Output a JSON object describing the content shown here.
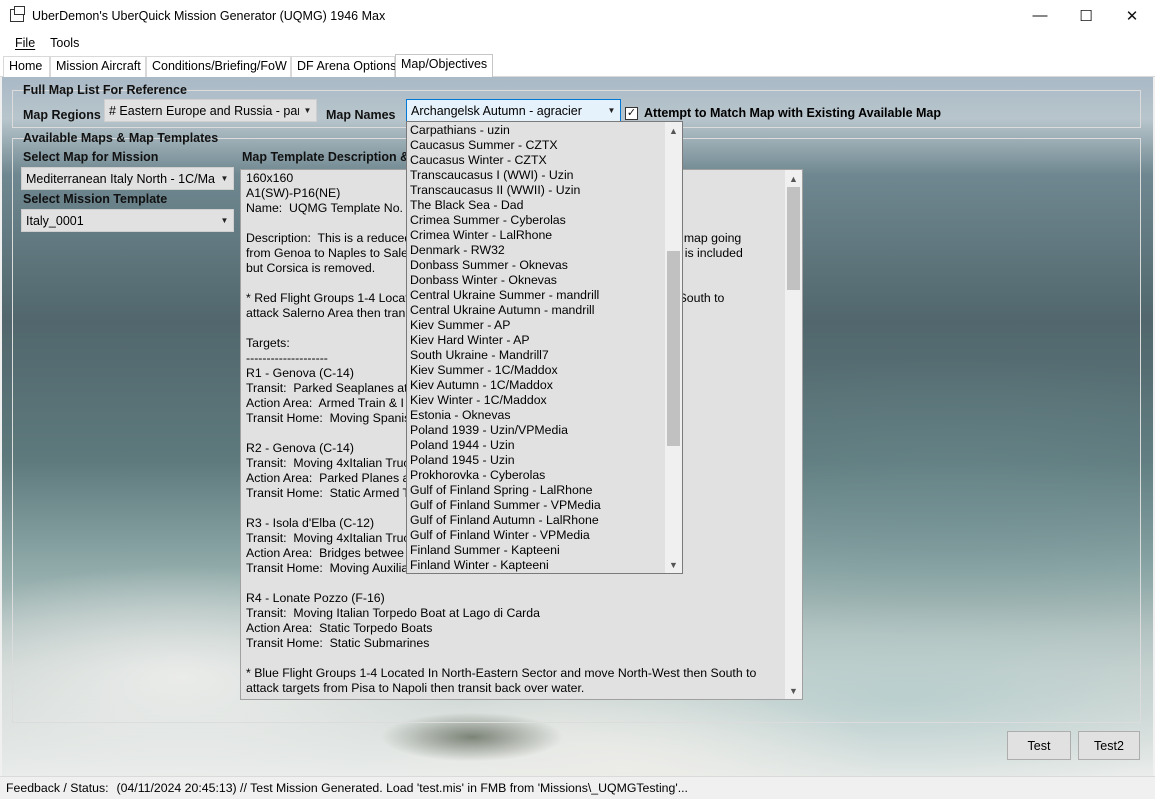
{
  "window": {
    "title": "UberDemon's UberQuick Mission Generator (UQMG) 1946 Max",
    "controls": {
      "minimize": "—",
      "maximize": "☐",
      "close": "✕"
    }
  },
  "menu": {
    "items": [
      {
        "label": "File"
      },
      {
        "label": "Tools"
      }
    ]
  },
  "tabs": [
    {
      "label": "Home"
    },
    {
      "label": "Mission Aircraft"
    },
    {
      "label": "Conditions/Briefing/FoW"
    },
    {
      "label": "DF Arena Options"
    },
    {
      "label": "Map/Objectives",
      "active": true
    }
  ],
  "full_map_list": {
    "group_label": "Full Map List For Reference",
    "regions_label": "Map Regions",
    "regions_value": "# Eastern Europe and Russia - part",
    "names_label": "Map Names",
    "names_value": "Archangelsk Autumn - agracier",
    "match_checkbox": {
      "checked": true,
      "label": "Attempt to Match Map with Existing Available Map"
    }
  },
  "available": {
    "group_label": "Available Maps & Map Templates",
    "select_map_label": "Select Map for Mission",
    "select_map_value": "Mediterranean Italy North - 1C/Ma",
    "select_template_label": "Select Mission Template",
    "select_template_value": "Italy_0001",
    "description_label": "Map Template Description & I"
  },
  "description_lines": [
    "160x160",
    "A1(SW)-P16(NE)",
    "Name:  UQMG Template No.",
    "",
    "Description:  This is a reduced                                                                          ale map going",
    "from Genoa to Naples to Sale                                                                            nd is included",
    "but Corsica is removed.",
    "",
    "* Red Flight Groups 1-4 Locat                                                                          en South to",
    "attack Salerno Area then tran",
    "",
    "Targets:",
    "--------------------",
    "R1 - Genova (C-14)",
    "Transit:  Parked Seaplanes at L",
    "Action Area:  Armed Train & I",
    "Transit Home:  Moving Spanis",
    "",
    "R2 - Genova (C-14)",
    "Transit:  Moving 4xItalian Truc",
    "Action Area:  Parked Planes at",
    "Transit Home:  Static Armed T",
    "",
    "R3 - Isola d'Elba (C-12)",
    "Transit:  Moving 4xItalian Truc",
    "Action Area:  Bridges betwee",
    "Transit Home:  Moving Auxilia",
    "",
    "R4 - Lonate Pozzo (F-16)",
    "Transit:  Moving Italian Torpedo Boat at Lago di Carda",
    "Action Area:  Static Torpedo Boats",
    "Transit Home:  Static Submarines",
    "",
    "* Blue Flight Groups 1-4 Located In North-Eastern Sector and move North-West then South to",
    "attack targets from Pisa to Napoli then transit back over water."
  ],
  "dropdown_options": [
    "Carpathians - uzin",
    "Caucasus Summer - CZTX",
    "Caucasus Winter - CZTX",
    "Transcaucasus I (WWI) - Uzin",
    "Transcaucasus II (WWII) - Uzin",
    "The Black Sea - Dad",
    "Crimea Summer - Cyberolas",
    "Crimea Winter - LalRhone",
    "Denmark - RW32",
    "Donbass Summer - Oknevas",
    "Donbass Winter - Oknevas",
    "Central Ukraine Summer - mandrill",
    "Central Ukraine Autumn - mandrill",
    "Kiev Summer - AP",
    "Kiev Hard Winter - AP",
    "South Ukraine - Mandrill7",
    "Kiev Summer - 1C/Maddox",
    "Kiev Autumn - 1C/Maddox",
    "Kiev Winter - 1C/Maddox",
    "Estonia - Oknevas",
    "Poland 1939 - Uzin/VPMedia",
    "Poland 1944 - Uzin",
    "Poland 1945 - Uzin",
    "Prokhorovka - Cyberolas",
    "Gulf of Finland Spring - LalRhone",
    "Gulf of Finland Summer - VPMedia",
    "Gulf of Finland Autumn - LalRhone",
    "Gulf of Finland Winter - VPMedia",
    "Finland Summer - Kapteeni",
    "Finland Winter - Kapteeni"
  ],
  "buttons": {
    "test": "Test",
    "test2": "Test2"
  },
  "status": {
    "label": "Feedback / Status:",
    "text": "(04/11/2024 20:45:13) // Test Mission Generated.  Load 'test.mis' in FMB from 'Missions\\_UQMGTesting'..."
  },
  "icons": {
    "app": "app-window-icon",
    "dropdown_arrow": "chevron-down-icon",
    "scroll_up": "chevron-up-icon",
    "scroll_down": "chevron-down-icon"
  },
  "colors": {
    "focus_accent": "#0078d7",
    "control_bg": "#e1e1e1",
    "window_bg": "#f0f0f0"
  }
}
